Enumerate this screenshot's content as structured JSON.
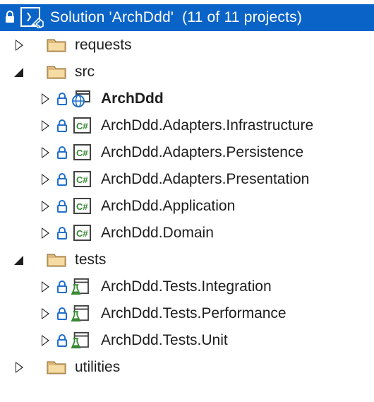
{
  "colors": {
    "selection": "#0a64c8",
    "folder": "#dcb67a",
    "lock": "#1f6fcc",
    "csharp": "#388a34",
    "test": "#388a34"
  },
  "solution": {
    "title": "Solution 'ArchDdd'  (11 of 11 projects)"
  },
  "tree": {
    "requests": "requests",
    "src": "src",
    "archddd": "ArchDdd",
    "infra": "ArchDdd.Adapters.Infrastructure",
    "persist": "ArchDdd.Adapters.Persistence",
    "present": "ArchDdd.Adapters.Presentation",
    "app": "ArchDdd.Application",
    "domain": "ArchDdd.Domain",
    "tests": "tests",
    "integration": "ArchDdd.Tests.Integration",
    "performance": "ArchDdd.Tests.Performance",
    "unit": "ArchDdd.Tests.Unit",
    "utilities": "utilities"
  }
}
